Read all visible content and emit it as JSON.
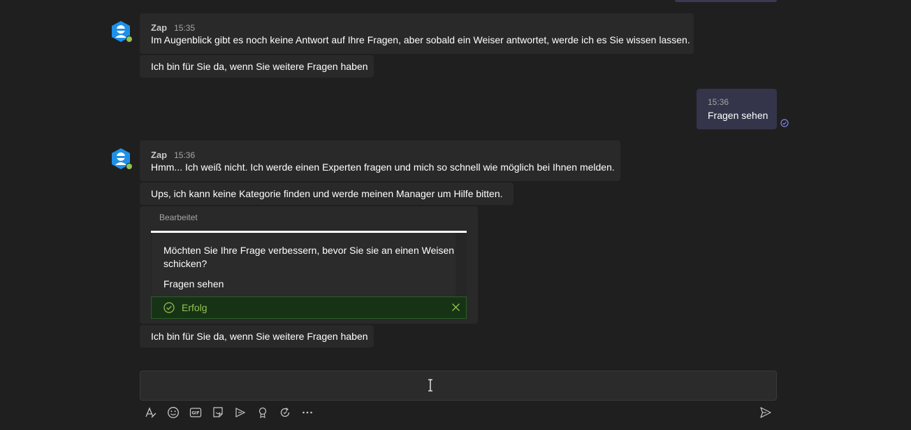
{
  "colors": {
    "background": "#1f1f1f",
    "bot_bubble": "#292929",
    "own_bubble": "#34344a",
    "success_bg": "#173315",
    "success_text": "#92c353",
    "accent": "#7f85f5"
  },
  "messages": [
    {
      "sender": "Zap",
      "time": "15:35",
      "text": "Im Augenblick gibt es noch keine Antwort auf Ihre Fragen, aber sobald ein Weiser antwortet, werde ich es Sie wissen lassen.",
      "followup": "Ich bin für Sie da, wenn Sie weitere Fragen haben"
    },
    {
      "own": true,
      "time": "15:36",
      "text": "Fragen sehen"
    },
    {
      "sender": "Zap",
      "time": "15:36",
      "text": "Hmm... Ich weiß nicht. Ich werde einen Experten fragen und mich so schnell wie möglich bei Ihnen melden.",
      "followup": "Ups, ich kann keine Kategorie finden und werde meinen Manager um Hilfe bitten.",
      "card": {
        "edited_label": "Bearbeitet",
        "question": "Möchten Sie Ihre Frage verbessern, bevor Sie sie an einen Weisen schicken?",
        "action": "Fragen sehen",
        "status": "Erfolg"
      },
      "closing": "Ich bin für Sie da, wenn Sie weitere Fragen haben"
    }
  ],
  "compose": {
    "tools": [
      "format-icon",
      "emoji-icon",
      "gif-icon",
      "sticker-icon",
      "meet-icon",
      "praise-icon",
      "loop-icon",
      "more-icon"
    ],
    "send_icon": "send-icon"
  }
}
